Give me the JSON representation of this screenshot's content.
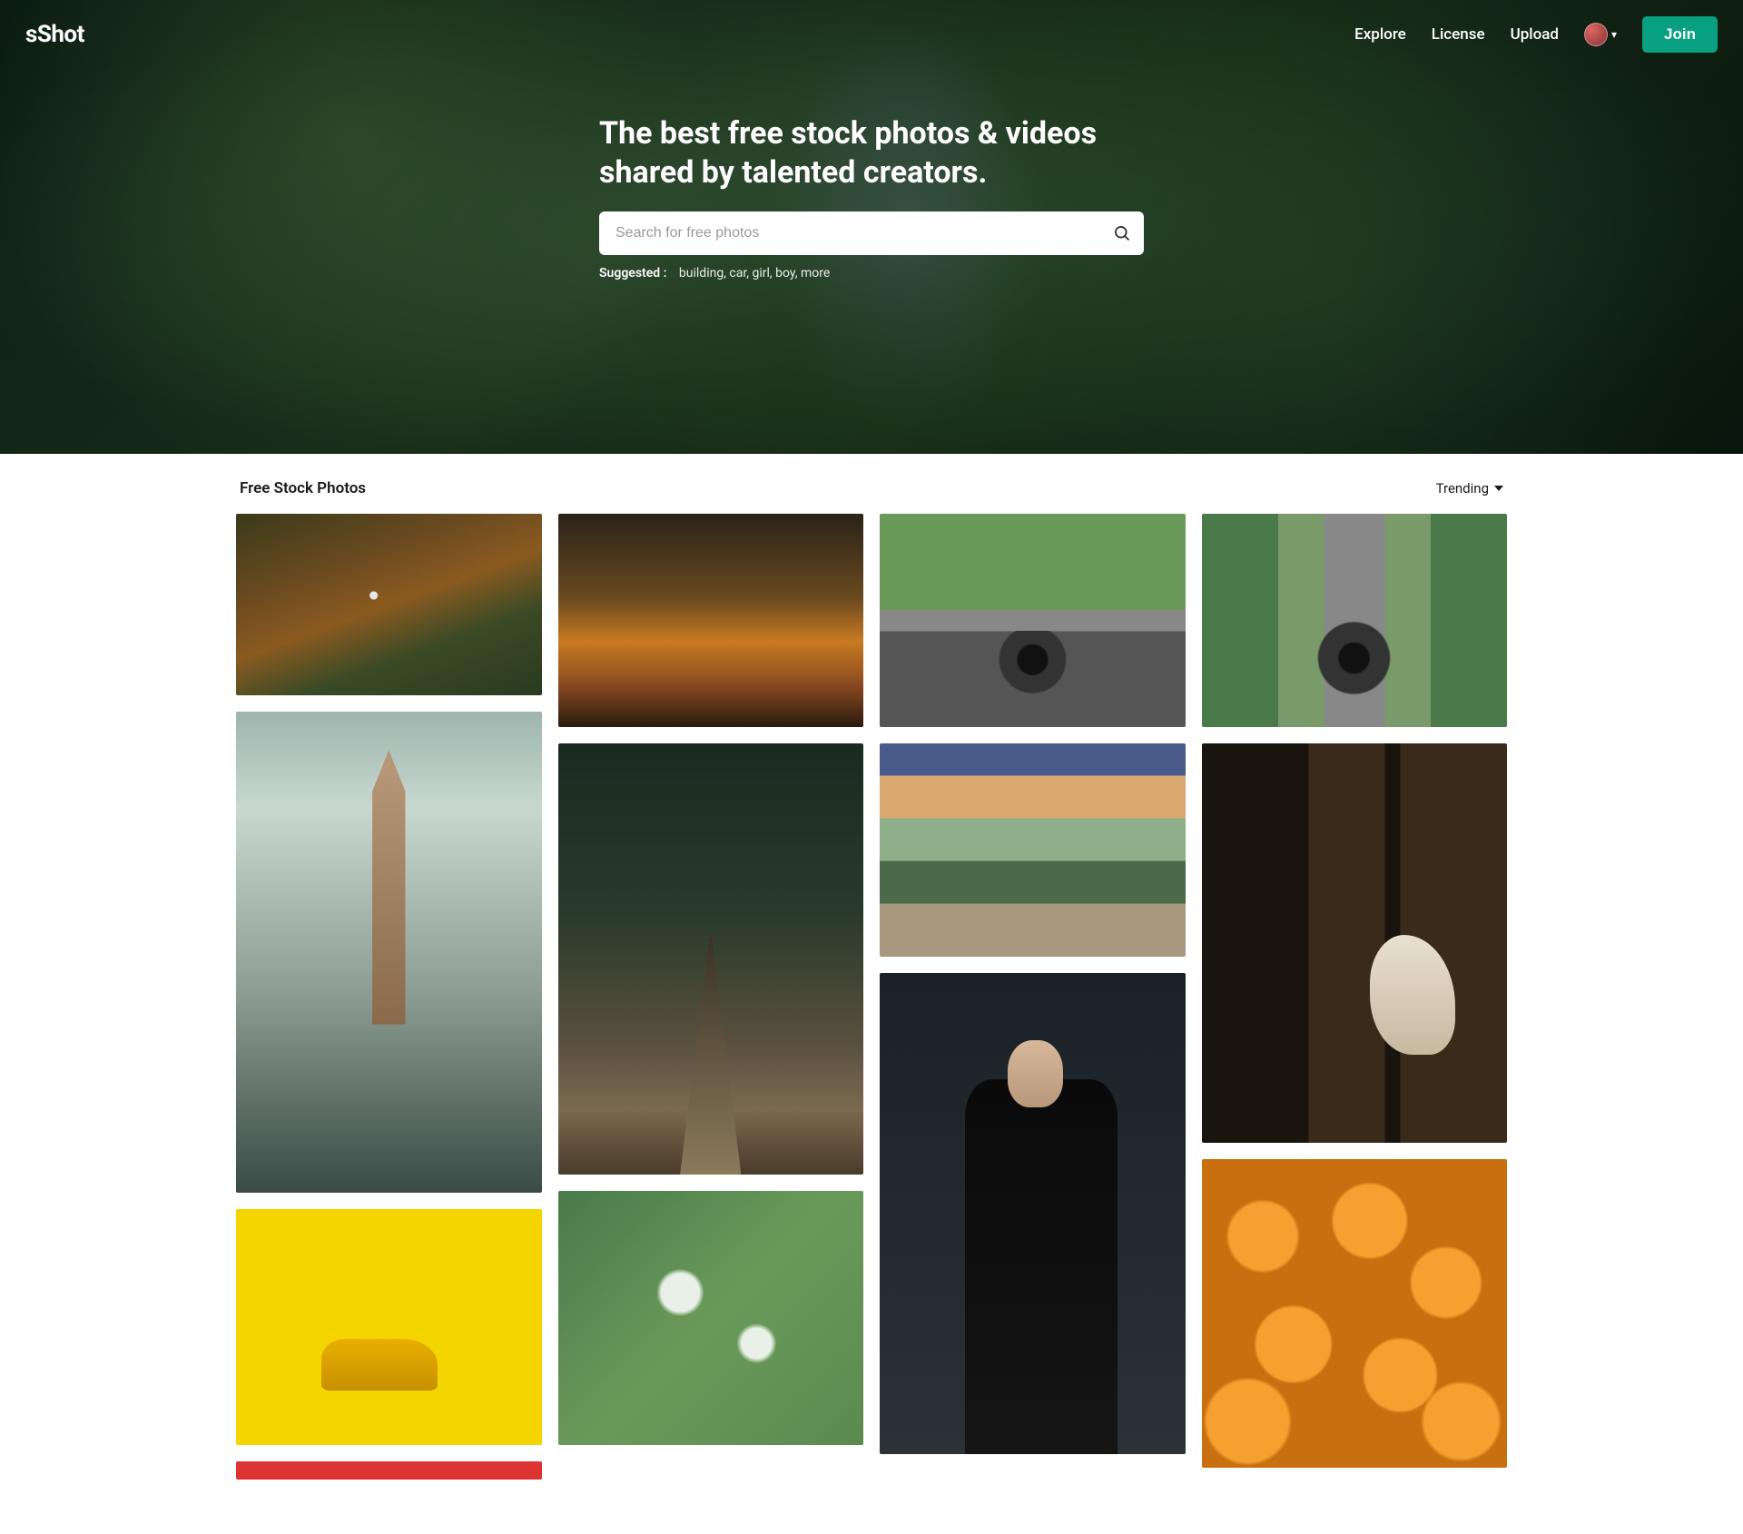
{
  "brand": "sShot",
  "nav": {
    "explore": "Explore",
    "license": "License",
    "upload": "Upload",
    "join": "Join"
  },
  "hero": {
    "title": "The best free stock photos & videos shared by talented creators.",
    "search_placeholder": "Search for free photos",
    "suggested_label": "Suggested :",
    "suggested_terms": "building, car, girl, boy, more"
  },
  "section": {
    "title": "Free Stock Photos",
    "sort": "Trending"
  },
  "columns": [
    [
      {
        "name": "autumn-forest-aerial",
        "cls": "c-forest1"
      },
      {
        "name": "historic-tower-street",
        "cls": "c-tower"
      },
      {
        "name": "yellow-toy-car",
        "cls": "c-yellow"
      },
      {
        "name": "red-abstract",
        "cls": "c-red"
      }
    ],
    [
      {
        "name": "autumn-trees",
        "cls": "c-autumn"
      },
      {
        "name": "forest-path",
        "cls": "c-path"
      },
      {
        "name": "green-foliage-aerial",
        "cls": "c-green"
      }
    ],
    [
      {
        "name": "motorcycle-forest-road",
        "cls": "c-moto1"
      },
      {
        "name": "palm-sunset-road",
        "cls": "c-palm"
      },
      {
        "name": "man-in-suit",
        "cls": "c-man"
      }
    ],
    [
      {
        "name": "motorcycle-highway",
        "cls": "c-moto2"
      },
      {
        "name": "deer-behind-tree",
        "cls": "c-deer"
      },
      {
        "name": "oranges-pile",
        "cls": "c-orange"
      }
    ]
  ]
}
